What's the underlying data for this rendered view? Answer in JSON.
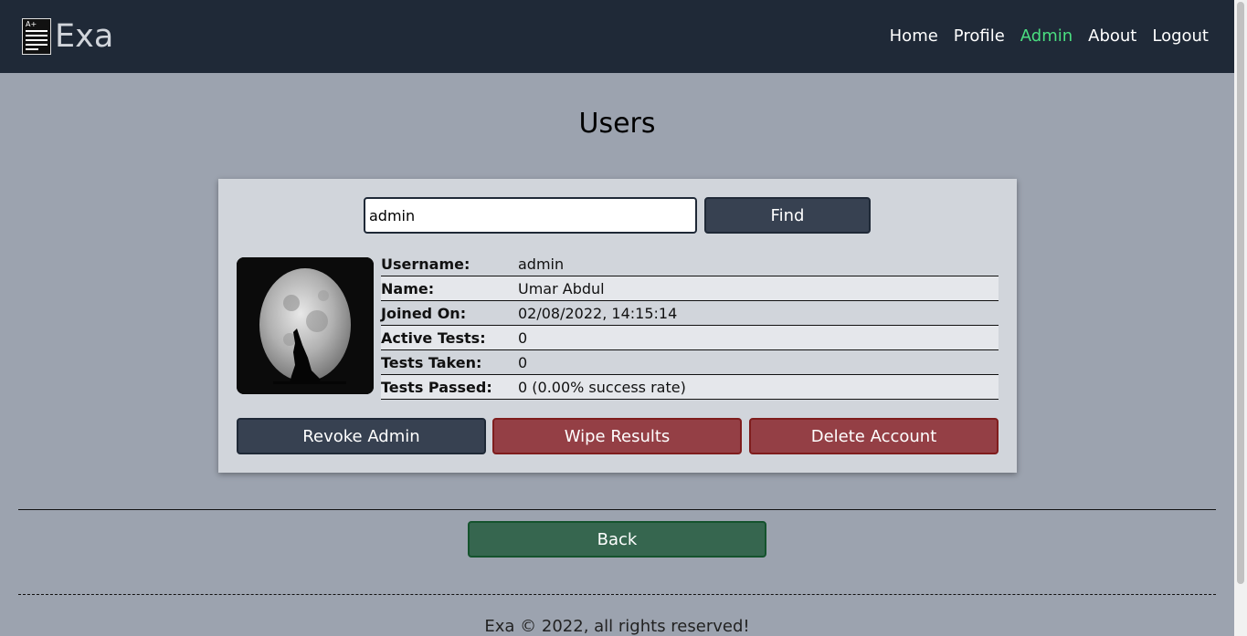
{
  "brand": {
    "name": "Exa",
    "logo_badge": "A+"
  },
  "nav": {
    "items": [
      {
        "label": "Home",
        "active": false
      },
      {
        "label": "Profile",
        "active": false
      },
      {
        "label": "Admin",
        "active": true
      },
      {
        "label": "About",
        "active": false
      },
      {
        "label": "Logout",
        "active": false
      }
    ]
  },
  "page": {
    "title": "Users"
  },
  "search": {
    "value": "admin",
    "button_label": "Find"
  },
  "user": {
    "avatar_icon": "moon-wolf-avatar",
    "fields": [
      {
        "label": "Username:",
        "value": "admin"
      },
      {
        "label": "Name:",
        "value": "Umar Abdul"
      },
      {
        "label": "Joined On:",
        "value": "02/08/2022, 14:15:14"
      },
      {
        "label": "Active Tests:",
        "value": "0"
      },
      {
        "label": "Tests Taken:",
        "value": "0"
      },
      {
        "label": "Tests Passed:",
        "value": "0 (0.00% success rate)"
      }
    ]
  },
  "actions": {
    "revoke_label": "Revoke Admin",
    "wipe_label": "Wipe Results",
    "delete_label": "Delete Account"
  },
  "back_label": "Back",
  "footer": {
    "text": "Exa © 2022, all rights reserved!"
  },
  "colors": {
    "navbar": "#1f2937",
    "active_nav": "#4ade80",
    "danger": "#943f45",
    "success": "#36664f",
    "dark_button": "#374151"
  }
}
